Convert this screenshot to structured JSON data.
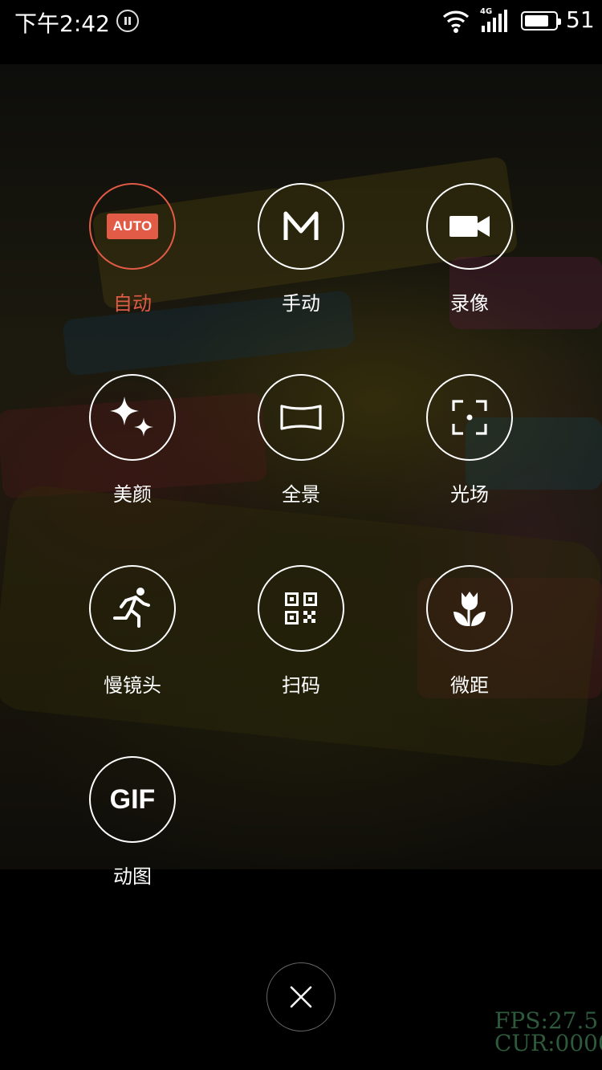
{
  "status_bar": {
    "time": "下午2:42",
    "network": "4G",
    "battery_level": "51",
    "battery_fraction": 0.8,
    "icons": [
      "pause-circle-icon",
      "wifi-icon",
      "cellular-signal-icon",
      "battery-icon"
    ]
  },
  "modes": [
    {
      "id": "auto",
      "label": "自动",
      "badge": "AUTO",
      "icon": "auto-badge-icon",
      "active": true
    },
    {
      "id": "manual",
      "label": "手动",
      "icon": "manual-m-icon",
      "active": false
    },
    {
      "id": "video",
      "label": "录像",
      "icon": "video-camera-icon",
      "active": false
    },
    {
      "id": "beauty",
      "label": "美颜",
      "icon": "sparkle-icon",
      "active": false
    },
    {
      "id": "panorama",
      "label": "全景",
      "icon": "panorama-icon",
      "active": false
    },
    {
      "id": "light-field",
      "label": "光场",
      "icon": "focus-frame-icon",
      "active": false
    },
    {
      "id": "slow-motion",
      "label": "慢镜头",
      "icon": "running-man-icon",
      "active": false
    },
    {
      "id": "scan",
      "label": "扫码",
      "icon": "qr-code-icon",
      "active": false
    },
    {
      "id": "macro",
      "label": "微距",
      "icon": "tulip-flower-icon",
      "active": false
    },
    {
      "id": "gif",
      "label": "动图",
      "badge": "GIF",
      "icon": "gif-icon",
      "active": false
    }
  ],
  "close": {
    "icon": "close-icon"
  },
  "debug": {
    "fps": "FPS:27.5",
    "cur": "CUR:0000"
  },
  "colors": {
    "accent": "#e15b47",
    "background": "#000000",
    "text": "#ffffff",
    "debug_text": "#2e5a3c"
  }
}
